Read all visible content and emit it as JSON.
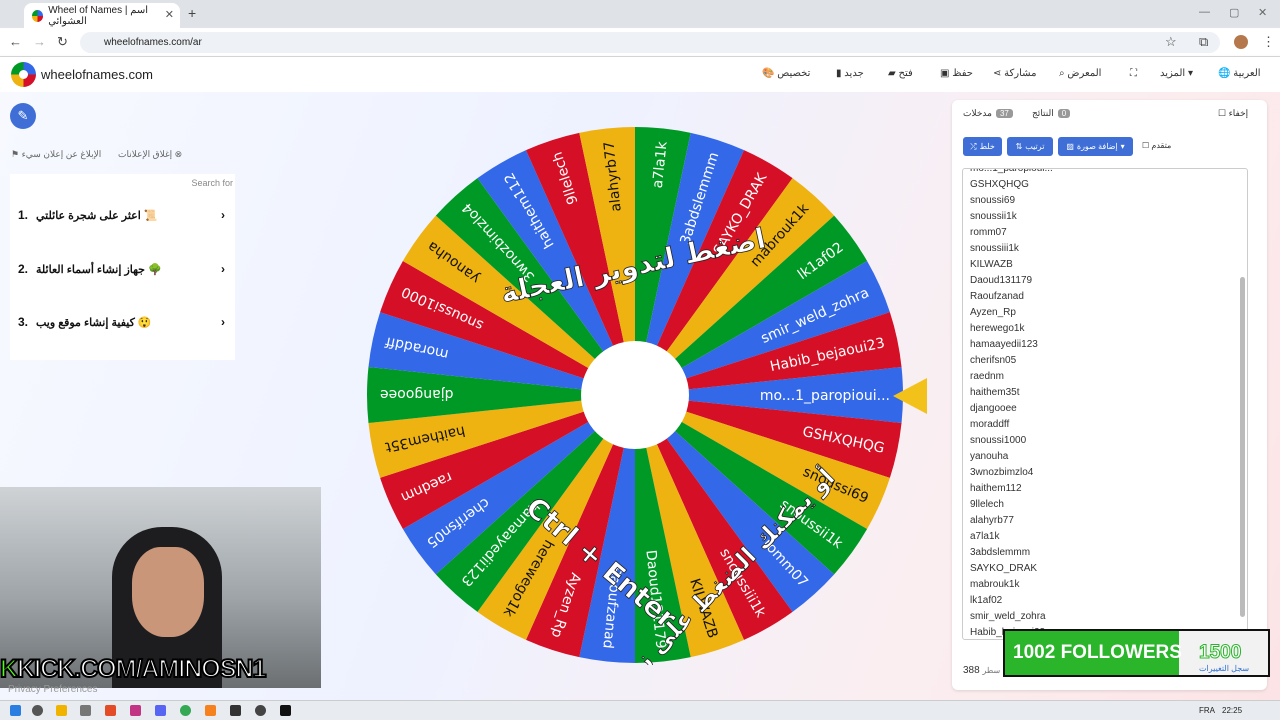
{
  "browser": {
    "tab_title": "Wheel of Names | اسم العشوائي",
    "new_tab": "+",
    "url": "wheelofnames.com/ar",
    "win_min": "—",
    "win_max": "▢",
    "win_close": "✕"
  },
  "site": {
    "brand": "wheelofnames.com",
    "menu": {
      "customize": "تخصيص",
      "new": "جديد",
      "open": "فتح",
      "save": "حفظ",
      "share": "مشاركة",
      "gallery": "المعرض",
      "more": "المزيد",
      "language": "العربية"
    }
  },
  "ads": {
    "close_ads": "إغلاق الإعلانات",
    "report_ad": "الإبلاغ عن إعلان سيء",
    "search_for": "Search for",
    "items": [
      {
        "num": "1.",
        "text": "اعثر على شجرة عائلتي 📜"
      },
      {
        "num": "2.",
        "text": "جهاز إنشاء أسماء العائلة 🌳"
      },
      {
        "num": "3.",
        "text": "كيفية إنشاء موقع ويب 😲"
      }
    ]
  },
  "wheel": {
    "overlay_line1": "اضغط لتدوير العجلة",
    "overlay_line2": "أو يمكنك الضغط على زر",
    "overlay_line3": "Ctrl + Enter",
    "colors": [
      "#3369e8",
      "#d50f25",
      "#eeb211",
      "#009925"
    ]
  },
  "panel": {
    "hide": "إخفاء",
    "results_label": "النتائج",
    "results_count": "0",
    "entries_label": "مدخلات",
    "entries_count": "37",
    "advanced": "متقدم",
    "add_image": "إضافة صورة",
    "sort": "ترتيب",
    "shuffle": "خلط",
    "entries": [
      "mo...1_paropioui...",
      "GSHXQHQG",
      "snoussi69",
      "snoussii1k",
      "romm07",
      "snoussiii1k",
      "KILWAZB",
      "Daoud131179",
      "Raoufzanad",
      "Ayzen_Rp",
      "herewego1k",
      "hamaayedii123",
      "cherifsn05",
      "raednm",
      "haithem35t",
      "djangooee",
      "moraddff",
      "snoussi1000",
      "yanouha",
      "3wnozbimzlo4",
      "haithem112",
      "9llelech",
      "alahyrb77",
      "a7la1k",
      "3abdslemmm",
      "SAYKO_DRAK",
      "mabrouk1k",
      "lk1af02",
      "smir_weld_zohra",
      "Habib_bejaoui23"
    ],
    "footer_count": "388",
    "footer_label": "سطر"
  },
  "overlay": {
    "followers_current": "1002",
    "followers_label": "FOLLOWERS",
    "followers_goal": "1500",
    "changes_link": "سجل التغييرات",
    "kick_k": "K",
    "kick_text": "KICK.COM/AMINOSN1",
    "privacy": "Privacy Preferences"
  },
  "taskbar": {
    "lang": "FRA",
    "time": "22:25"
  }
}
